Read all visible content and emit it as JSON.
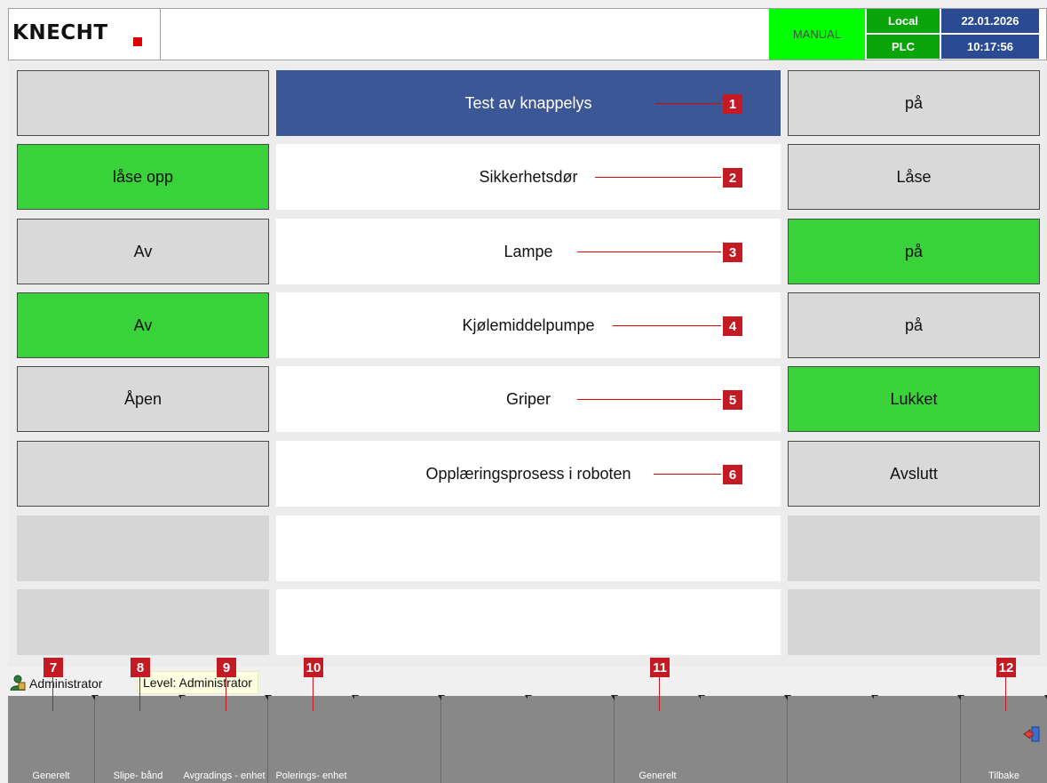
{
  "header": {
    "logo": "KNECHT",
    "mode": "MANUAL",
    "local_label": "Local",
    "plc_label": "PLC",
    "date": "22.01.2026",
    "time": "10:17:56",
    "colors": {
      "mode": "#00ff00",
      "local": "#0aa50a",
      "datetime": "#2a4a94",
      "logo_dot": "#e00000"
    }
  },
  "rows": [
    {
      "left": "",
      "label": "Test av knappelys",
      "right": "på",
      "callout": "1"
    },
    {
      "left": "låse opp",
      "label": "Sikkerhetsdør",
      "right": "Låse",
      "callout": "2"
    },
    {
      "left": "Av",
      "label": "Lampe",
      "right": "på",
      "callout": "3"
    },
    {
      "left": "Av",
      "label": "Kjølemiddelpumpe",
      "right": "på",
      "callout": "4"
    },
    {
      "left": "Åpen",
      "label": "Griper",
      "right": "Lukket",
      "callout": "5"
    },
    {
      "left": "",
      "label": "Opplæringsprosess i roboten",
      "right": "Avslutt",
      "callout": "6"
    }
  ],
  "status": {
    "user": "Administrator",
    "level": "Level: Administrator"
  },
  "tabs": [
    {
      "label": "Generelt",
      "callout": "7"
    },
    {
      "label": "Slipe- bånd",
      "callout": "8"
    },
    {
      "label": "Avgradings - enhet",
      "callout": "9"
    },
    {
      "label": "Polerings- enhet",
      "callout": "10"
    },
    {
      "label": ""
    },
    {
      "label": ""
    },
    {
      "label": ""
    },
    {
      "label": "Generelt",
      "callout": "11"
    },
    {
      "label": ""
    },
    {
      "label": ""
    },
    {
      "label": ""
    },
    {
      "label": "Tilbake",
      "callout": "12",
      "icon": "exit-icon"
    }
  ],
  "colors": {
    "active_green": "#3ad23a",
    "title_blue": "#3c5796",
    "callout_red": "#c41a24"
  }
}
